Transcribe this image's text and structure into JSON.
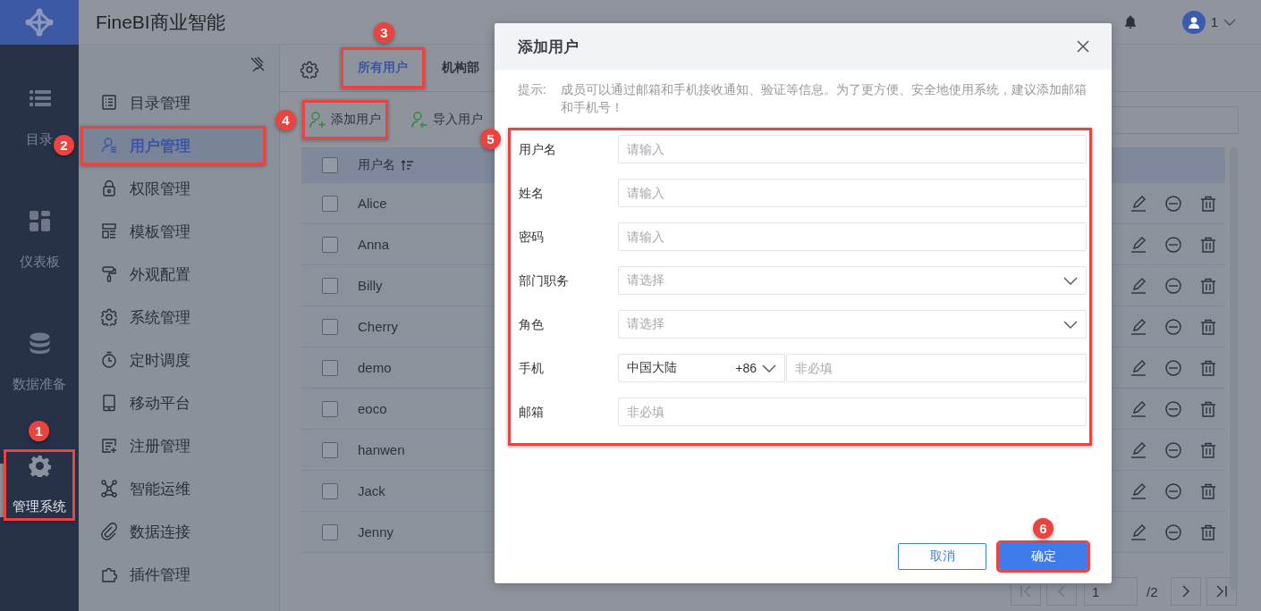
{
  "header": {
    "title": "FineBI商业智能",
    "user": "1"
  },
  "rail": [
    {
      "label": "目录",
      "selected": false
    },
    {
      "label": "仪表板",
      "selected": false
    },
    {
      "label": "数据准备",
      "selected": false
    },
    {
      "label": "管理系统",
      "selected": true,
      "callout": "1"
    }
  ],
  "subnav": [
    {
      "label": "目录管理",
      "selected": false
    },
    {
      "label": "用户管理",
      "selected": true,
      "callout": "2"
    },
    {
      "label": "权限管理",
      "selected": false
    },
    {
      "label": "模板管理",
      "selected": false
    },
    {
      "label": "外观配置",
      "selected": false
    },
    {
      "label": "系统管理",
      "selected": false
    },
    {
      "label": "定时调度",
      "selected": false
    },
    {
      "label": "移动平台",
      "selected": false
    },
    {
      "label": "注册管理",
      "selected": false
    },
    {
      "label": "智能运维",
      "selected": false
    },
    {
      "label": "数据连接",
      "selected": false
    },
    {
      "label": "插件管理",
      "selected": false
    }
  ],
  "tabs": [
    {
      "label": "所有用户",
      "selected": true,
      "callout": "3"
    },
    {
      "label": "机构部",
      "selected": false
    }
  ],
  "toolbar": [
    {
      "label": "添加用户",
      "callout": "4"
    },
    {
      "label": "导入用户"
    }
  ],
  "table": {
    "header": {
      "label": "用户名",
      "checked": false
    },
    "rows": [
      {
        "name": "Alice",
        "checked": false
      },
      {
        "name": "Anna",
        "checked": false
      },
      {
        "name": "Billy",
        "checked": false
      },
      {
        "name": "Cherry",
        "checked": false
      },
      {
        "name": "demo",
        "checked": false
      },
      {
        "name": "eoco",
        "checked": false
      },
      {
        "name": "hanwen",
        "checked": false
      },
      {
        "name": "Jack",
        "checked": false
      },
      {
        "name": "Jenny",
        "checked": false
      }
    ]
  },
  "pagination": {
    "page": "1",
    "total": "/2"
  },
  "dialog": {
    "title": "添加用户",
    "hint_label": "提示:",
    "hint": "成员可以通过邮箱和手机接收通知、验证等信息。为了更方便、安全地使用系统，建议添加邮箱和手机号！",
    "form": {
      "callout": "5",
      "fields": [
        {
          "kind": "text",
          "label": "用户名",
          "placeholder": "请输入"
        },
        {
          "kind": "text",
          "label": "姓名",
          "placeholder": "请输入"
        },
        {
          "kind": "text",
          "label": "密码",
          "placeholder": "请输入"
        },
        {
          "kind": "select",
          "label": "部门职务",
          "placeholder": "请选择"
        },
        {
          "kind": "select",
          "label": "角色",
          "placeholder": "请选择"
        },
        {
          "kind": "phone",
          "label": "手机",
          "region": "中国大陆",
          "code": "+86",
          "placeholder": "非必填"
        },
        {
          "kind": "text",
          "label": "邮箱",
          "placeholder": "非必填"
        }
      ]
    },
    "buttons": [
      {
        "kind": "secondary",
        "label": "取消"
      },
      {
        "kind": "primary",
        "label": "确定",
        "callout": "6"
      }
    ]
  }
}
